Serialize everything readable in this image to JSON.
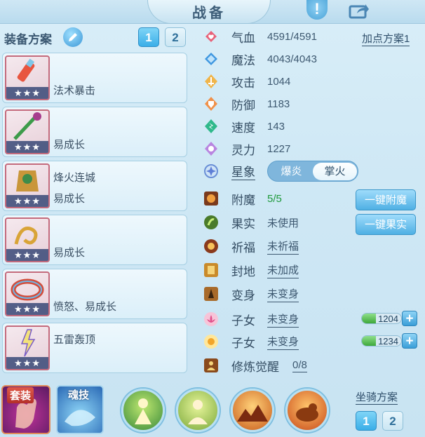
{
  "header": {
    "title": "战备"
  },
  "left": {
    "plan_label": "装备方案",
    "plan_tabs": [
      "1",
      "2"
    ],
    "equipment": [
      {
        "line1": "",
        "line2": "法术暴击",
        "stars": "★★★",
        "icon": "brush-relic-icon"
      },
      {
        "line1": "",
        "line2": "易成长",
        "stars": "★★★",
        "icon": "green-staff-icon"
      },
      {
        "line1": "烽火连城",
        "line2": "易成长",
        "stars": "★★★",
        "icon": "armor-relic-icon"
      },
      {
        "line1": "",
        "line2": "易成长",
        "stars": "★★★",
        "icon": "dragon-relic-icon"
      },
      {
        "line1": "",
        "line2": "愤怒、易成长",
        "stars": "★★★",
        "icon": "ring-relic-icon"
      },
      {
        "line1": "五雷轰顶",
        "line2": "",
        "stars": "★★★",
        "icon": "thunder-relic-icon"
      }
    ]
  },
  "stats": {
    "add_plan": "加点方案1",
    "hp": {
      "name": "气血",
      "value": "4591/4591"
    },
    "mp": {
      "name": "魔法",
      "value": "4043/4043"
    },
    "atk": {
      "name": "攻击",
      "value": "1044"
    },
    "def": {
      "name": "防御",
      "value": "1183"
    },
    "spd": {
      "name": "速度",
      "value": "143"
    },
    "spi": {
      "name": "灵力",
      "value": "1227"
    },
    "star": {
      "name": "星象",
      "opt_off": "爆炎",
      "opt_on": "掌火"
    },
    "enchant": {
      "name": "附魔",
      "value": "5/5",
      "button": "一键附魔"
    },
    "fruit": {
      "name": "果实",
      "value": "未使用",
      "button": "一键果实"
    },
    "bless": {
      "name": "祈福",
      "value": "未祈福"
    },
    "seal": {
      "name": "封地",
      "value": "未加成"
    },
    "transform": {
      "name": "变身",
      "value": "未变身"
    },
    "child1": {
      "name": "子女",
      "value": "未变身",
      "bar_value": 1204,
      "bar_fill": 0.35
    },
    "child2": {
      "name": "子女",
      "value": "未变身",
      "bar_value": 1234,
      "bar_fill": 0.35
    },
    "cultivate": {
      "name": "修炼觉醒",
      "value": "0/8"
    }
  },
  "bottom": {
    "suit_label": "套装",
    "soul_label": "魂技",
    "mount_label": "坐骑方案",
    "mount_tabs": [
      "1",
      "2"
    ]
  },
  "colors": {
    "accent": "#3aaee8",
    "green": "#1f9a3c",
    "text": "#344d63"
  }
}
